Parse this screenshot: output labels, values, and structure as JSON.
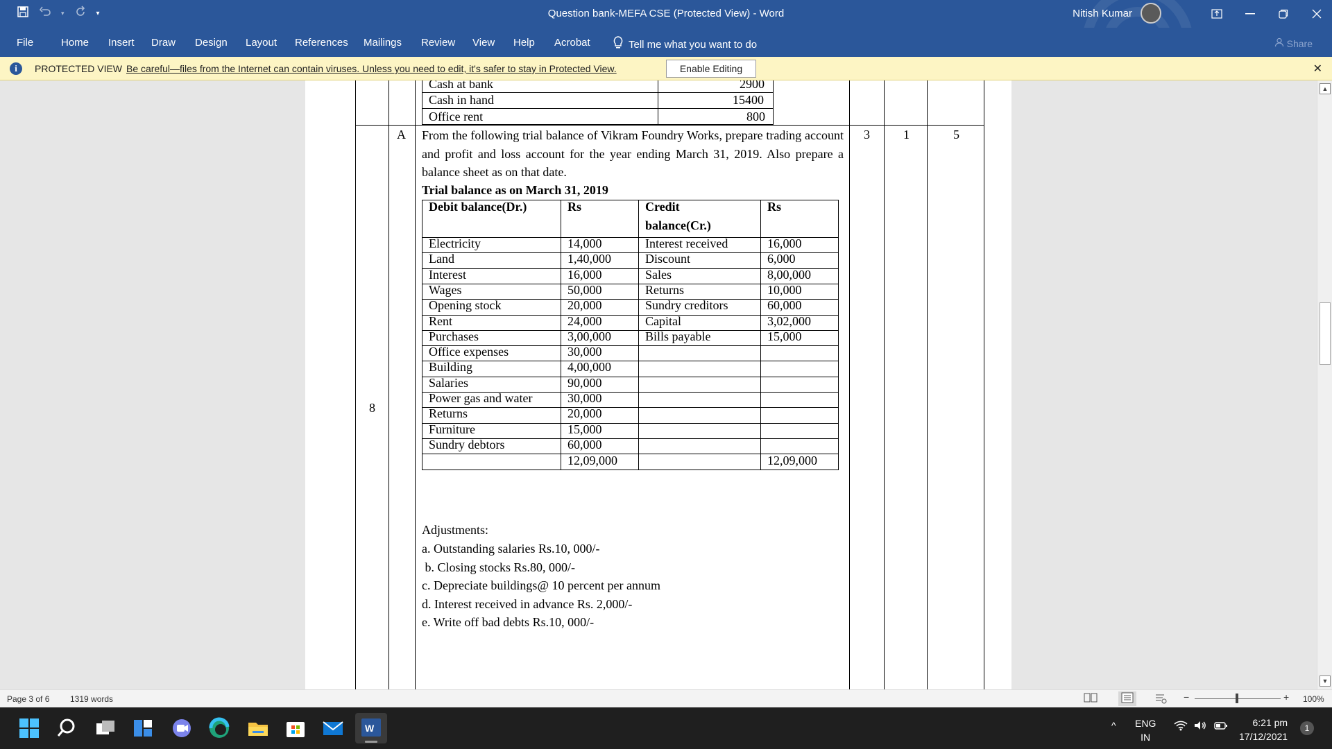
{
  "titlebar": {
    "title": "Question bank-MEFA CSE (Protected View)  -  Word",
    "user": "Nitish Kumar"
  },
  "ribbon": {
    "tabs": [
      "File",
      "Home",
      "Insert",
      "Draw",
      "Design",
      "Layout",
      "References",
      "Mailings",
      "Review",
      "View",
      "Help",
      "Acrobat"
    ],
    "tell_me": "Tell me what you want to do",
    "share": "Share"
  },
  "protected_bar": {
    "label": "PROTECTED VIEW",
    "message": "Be careful—files from the Internet can contain viruses. Unless you need to edit, it's safer to stay in Protected View.",
    "enable_button": "Enable Editing"
  },
  "document": {
    "top_rows": [
      {
        "item": "Cash at bank",
        "amount": "2900"
      },
      {
        "item": "Cash in hand",
        "amount": "15400"
      },
      {
        "item": "Office rent",
        "amount": "800"
      }
    ],
    "question": {
      "number": "8",
      "part": "A",
      "col1": "3",
      "col2": "1",
      "col3": "5",
      "text": "From the following trial balance of Vikram Foundry Works, prepare trading account and profit and loss account for the year ending March 31, 2019. Also prepare a balance sheet as on that date.",
      "table_title": "Trial balance as on March 31, 2019",
      "headers": {
        "debit": "Debit balance(Dr.)",
        "rs1": "Rs",
        "credit_line1": "Credit",
        "credit_line2": "balance(Cr.)",
        "rs2": "Rs"
      },
      "rows": [
        [
          "Electricity",
          "14,000",
          "Interest received",
          "16,000"
        ],
        [
          "Land",
          "1,40,000",
          "Discount",
          "6,000"
        ],
        [
          "Interest",
          "16,000",
          "Sales",
          "8,00,000"
        ],
        [
          "Wages",
          "50,000",
          "Returns",
          "10,000"
        ],
        [
          "Opening stock",
          "20,000",
          "Sundry creditors",
          "60,000"
        ],
        [
          "Rent",
          "24,000",
          "Capital",
          "3,02,000"
        ],
        [
          "Purchases",
          "3,00,000",
          "Bills payable",
          "15,000"
        ],
        [
          "Office expenses",
          "30,000",
          "",
          ""
        ],
        [
          "Building",
          "4,00,000",
          "",
          ""
        ],
        [
          "Salaries",
          "90,000",
          "",
          ""
        ],
        [
          "Power gas and water",
          "30,000",
          "",
          ""
        ],
        [
          "Returns",
          "20,000",
          "",
          ""
        ],
        [
          "Furniture",
          "15,000",
          "",
          ""
        ],
        [
          "Sundry debtors",
          "60,000",
          "",
          ""
        ]
      ],
      "total_dr": "12,09,000",
      "total_cr": "12,09,000",
      "adjustments_title": "Adjustments:",
      "adjustments": [
        "a. Outstanding salaries Rs.10, 000/-",
        " b. Closing stocks Rs.80, 000/-",
        "c. Depreciate buildings@ 10 percent per annum",
        "d. Interest received in advance Rs. 2,000/-",
        "e. Write off bad debts Rs.10, 000/-"
      ]
    }
  },
  "status": {
    "page": "Page 3 of 6",
    "words": "1319 words",
    "zoom": "100%"
  },
  "taskbar": {
    "lang_line1": "ENG",
    "lang_line2": "IN",
    "time": "6:21 pm",
    "date": "17/12/2021",
    "notif_count": "1"
  }
}
